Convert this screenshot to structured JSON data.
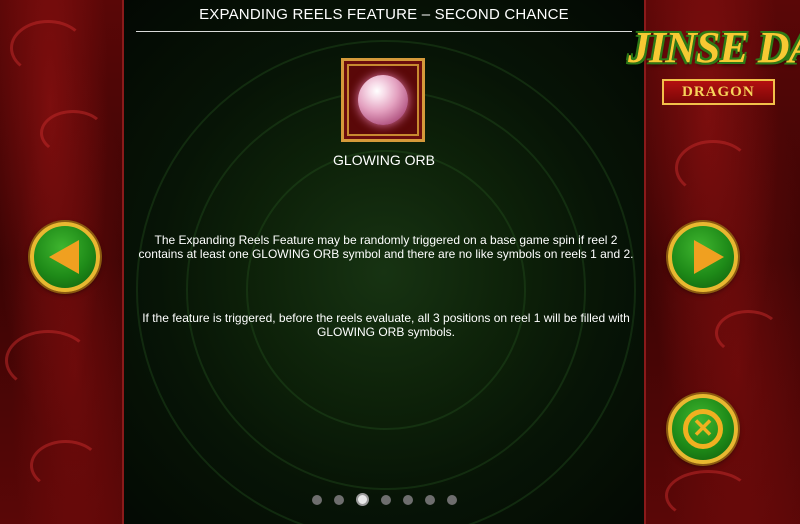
{
  "header": {
    "title": "EXPANDING REELS FEATURE – SECOND CHANCE"
  },
  "symbol": {
    "name": "GLOWING ORB",
    "icon": "glowing-orb-icon"
  },
  "body": {
    "paragraph_1": "The Expanding Reels Feature may be randomly triggered on a base game spin if reel 2 contains at least one GLOWING ORB symbol and there are no like symbols on reels 1 and 2.",
    "paragraph_2": "If the feature is triggered, before the reels evaluate, all 3 positions on reel 1 will be filled with GLOWING ORB symbols."
  },
  "logo": {
    "main": "JINSE DA",
    "sub": "DRAGON"
  },
  "pagination": {
    "total": 7,
    "current": 3
  },
  "controls": {
    "prev_icon": "arrow-left-icon",
    "next_icon": "arrow-right-icon",
    "close_icon": "close-icon"
  },
  "colors": {
    "button_green": "#1e8a18",
    "button_gold": "#e8b830",
    "text": "#ffffff",
    "panel": "#0d2109"
  }
}
